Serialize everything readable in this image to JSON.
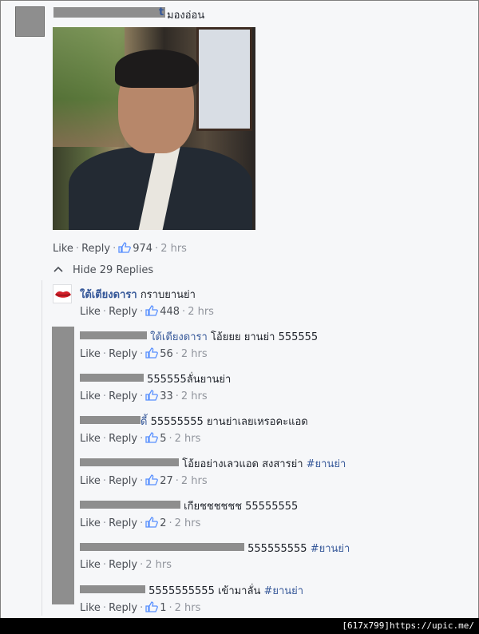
{
  "top_comment": {
    "name_tail": "t",
    "text": "มองอ่อน",
    "actions": {
      "like": "Like",
      "reply": "Reply",
      "likes": "974",
      "time": "2 hrs"
    }
  },
  "thread": {
    "hide_label": "Hide 29 Replies"
  },
  "replies": [
    {
      "name": "ใต้เตียงดารา",
      "text": "กราบยานย่า",
      "like": "Like",
      "reply": "Reply",
      "likes": "448",
      "time": "2 hrs"
    },
    {
      "name": "ใต้เตียงดารา",
      "text": "โอ้ยยย ยานย่า 555555",
      "like": "Like",
      "reply": "Reply",
      "likes": "56",
      "time": "2 hrs"
    },
    {
      "name": "",
      "text": "555555ลั่นยานย่า",
      "like": "Like",
      "reply": "Reply",
      "likes": "33",
      "time": "2 hrs"
    },
    {
      "name": "ดี้",
      "text": "55555555 ยานย่าเลยเหรอคะแอด",
      "like": "Like",
      "reply": "Reply",
      "likes": "5",
      "time": "2 hrs"
    },
    {
      "name": "",
      "text": "โอ้ยอย่างเลวแอด สงสารย่า",
      "tag": "#ยานย่า",
      "like": "Like",
      "reply": "Reply",
      "likes": "27",
      "time": "2 hrs"
    },
    {
      "name": "",
      "text": "เกียชชชชชช 55555555",
      "like": "Like",
      "reply": "Reply",
      "likes": "2",
      "time": "2 hrs"
    },
    {
      "name": "",
      "text": "555555555",
      "tag": "#ยานย่า",
      "like": "Like",
      "reply": "Reply",
      "likes": "",
      "time": "2 hrs"
    },
    {
      "name": "",
      "text": "5555555555 เข้ามาลั่น",
      "tag": "#ยานย่า",
      "like": "Like",
      "reply": "Reply",
      "likes": "1",
      "time": "2 hrs"
    }
  ],
  "watermark": "[617x799]https://upic.me/",
  "colors": {
    "link": "#365899",
    "muted": "#90949c",
    "redact": "#8e8e8e"
  }
}
